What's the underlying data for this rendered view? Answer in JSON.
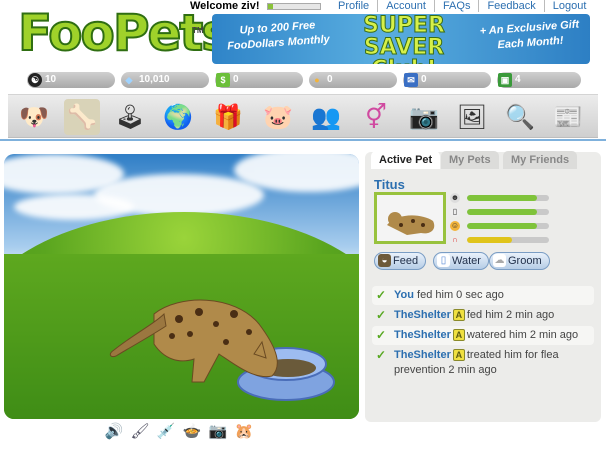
{
  "header": {
    "logo_text": "FooPets",
    "logo_tm": "TM",
    "welcome": "Welcome ziv!",
    "welcome_progress": 0.1,
    "links": [
      "Profile",
      "Account",
      "FAQs",
      "Feedback",
      "Logout"
    ]
  },
  "banner": {
    "left": "Up to 200 Free FooDollars Monthly",
    "mid": "SUPER SAVER Club!",
    "right": "+ An Exclusive Gift Each Month!"
  },
  "stats": [
    {
      "icon": "yin-yang-icon",
      "value": "10"
    },
    {
      "icon": "diamond-icon",
      "value": "10,010"
    },
    {
      "icon": "money-icon",
      "value": "0"
    },
    {
      "icon": "friends-icon",
      "value": "0"
    },
    {
      "icon": "mail-icon",
      "value": "0"
    },
    {
      "icon": "box-icon",
      "value": "4"
    }
  ],
  "nav": [
    {
      "name": "nav-adopt-icon",
      "glyph": "🐶"
    },
    {
      "name": "nav-my-pets-icon",
      "glyph": "🦴"
    },
    {
      "name": "nav-games-icon",
      "glyph": "🕹"
    },
    {
      "name": "nav-world-icon",
      "glyph": "🌍"
    },
    {
      "name": "nav-gifts-icon",
      "glyph": "🎁"
    },
    {
      "name": "nav-bank-icon",
      "glyph": "🐷"
    },
    {
      "name": "nav-friends-icon",
      "glyph": "👥"
    },
    {
      "name": "nav-dating-icon",
      "glyph": "⚥"
    },
    {
      "name": "nav-camera-icon",
      "glyph": "📷"
    },
    {
      "name": "nav-photos-icon",
      "glyph": "🖼"
    },
    {
      "name": "nav-search-icon",
      "glyph": "🔍"
    },
    {
      "name": "nav-news-icon",
      "glyph": "📰"
    }
  ],
  "panel": {
    "tabs": [
      "Active Pet",
      "My Pets",
      "My Friends"
    ],
    "active_tab": "Active Pet",
    "pet_name": "Titus",
    "pet_stats": [
      {
        "icon": "chef-icon",
        "level": 0.85,
        "color": "#7fc33a"
      },
      {
        "icon": "bottle-icon",
        "level": 0.85,
        "color": "#7fc33a"
      },
      {
        "icon": "smile-icon",
        "level": 0.85,
        "color": "#7fc33a"
      },
      {
        "icon": "magnet-icon",
        "level": 0.55,
        "color": "#e0c41a"
      }
    ],
    "actions": [
      {
        "name": "feed-button",
        "label": "Feed",
        "icon": "food-bowl-icon"
      },
      {
        "name": "water-button",
        "label": "Water",
        "icon": "water-icon"
      },
      {
        "name": "groom-button",
        "label": "Groom",
        "icon": "groom-icon"
      }
    ]
  },
  "feed": [
    {
      "who": "You",
      "badge": "",
      "action": "fed him 0 sec ago"
    },
    {
      "who": "TheShelter",
      "badge": "A",
      "action": "fed him 2 min ago"
    },
    {
      "who": "TheShelter",
      "badge": "A",
      "action": "watered him 2 min ago"
    },
    {
      "who": "TheShelter",
      "badge": "A",
      "action": "treated him for flea prevention 2 min ago"
    }
  ],
  "scene_icons": [
    "sound-icon",
    "brush-icon",
    "needle-icon",
    "food-dish-icon",
    "camera-icon",
    "toy-icon"
  ]
}
